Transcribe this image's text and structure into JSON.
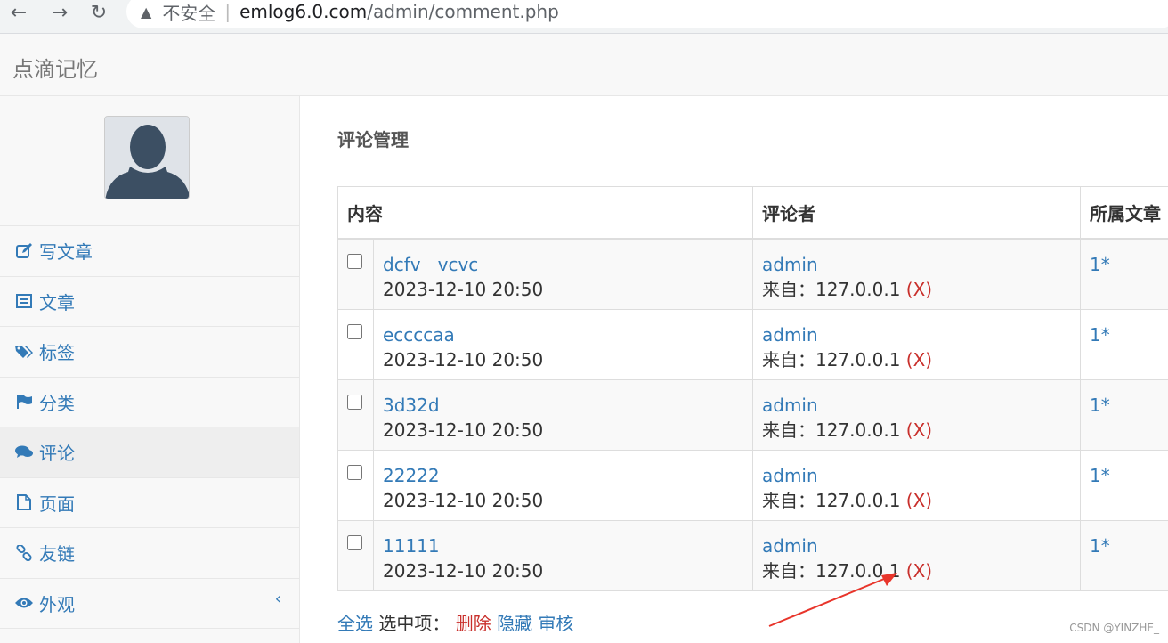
{
  "browser": {
    "insecure_label": "不安全",
    "separator": "|",
    "host": "emlog6.0.com",
    "path": "/admin/comment.php"
  },
  "header": {
    "brand": "点滴记忆"
  },
  "sidebar": {
    "items": [
      {
        "label": "写文章",
        "icon": "edit-icon"
      },
      {
        "label": "文章",
        "icon": "list-icon"
      },
      {
        "label": "标签",
        "icon": "tags-icon"
      },
      {
        "label": "分类",
        "icon": "flag-icon"
      },
      {
        "label": "评论",
        "icon": "comments-icon",
        "active": true
      },
      {
        "label": "页面",
        "icon": "file-icon"
      },
      {
        "label": "友链",
        "icon": "link-icon"
      },
      {
        "label": "外观",
        "icon": "eye-icon"
      }
    ],
    "collapse_glyph": "‹"
  },
  "main": {
    "title": "评论管理",
    "table": {
      "headers": [
        "内容",
        "评论者",
        "所属文章"
      ],
      "rows": [
        {
          "content": "dcfv   vcvc",
          "date": "2023-12-10 20:50",
          "author": "admin",
          "from_prefix": "来自：127.0.0.1 ",
          "delete_x": "(X)",
          "article": "1*"
        },
        {
          "content": "eccccaa",
          "date": "2023-12-10 20:50",
          "author": "admin",
          "from_prefix": "来自：127.0.0.1 ",
          "delete_x": "(X)",
          "article": "1*"
        },
        {
          "content": "3d32d",
          "date": "2023-12-10 20:50",
          "author": "admin",
          "from_prefix": "来自：127.0.0.1 ",
          "delete_x": "(X)",
          "article": "1*"
        },
        {
          "content": "22222",
          "date": "2023-12-10 20:50",
          "author": "admin",
          "from_prefix": "来自：127.0.0.1 ",
          "delete_x": "(X)",
          "article": "1*"
        },
        {
          "content": "11111",
          "date": "2023-12-10 20:50",
          "author": "admin",
          "from_prefix": "来自：127.0.0.1 ",
          "delete_x": "(X)",
          "article": "1*"
        }
      ]
    },
    "actions": {
      "select_all": "全选",
      "selected_label": "选中项：",
      "delete": "删除",
      "hide": "隐藏",
      "approve": "审核"
    }
  },
  "watermark": "CSDN @YINZHE_",
  "colors": {
    "link": "#337ab7",
    "danger": "#c9302c",
    "arrow": "#e8352b"
  }
}
